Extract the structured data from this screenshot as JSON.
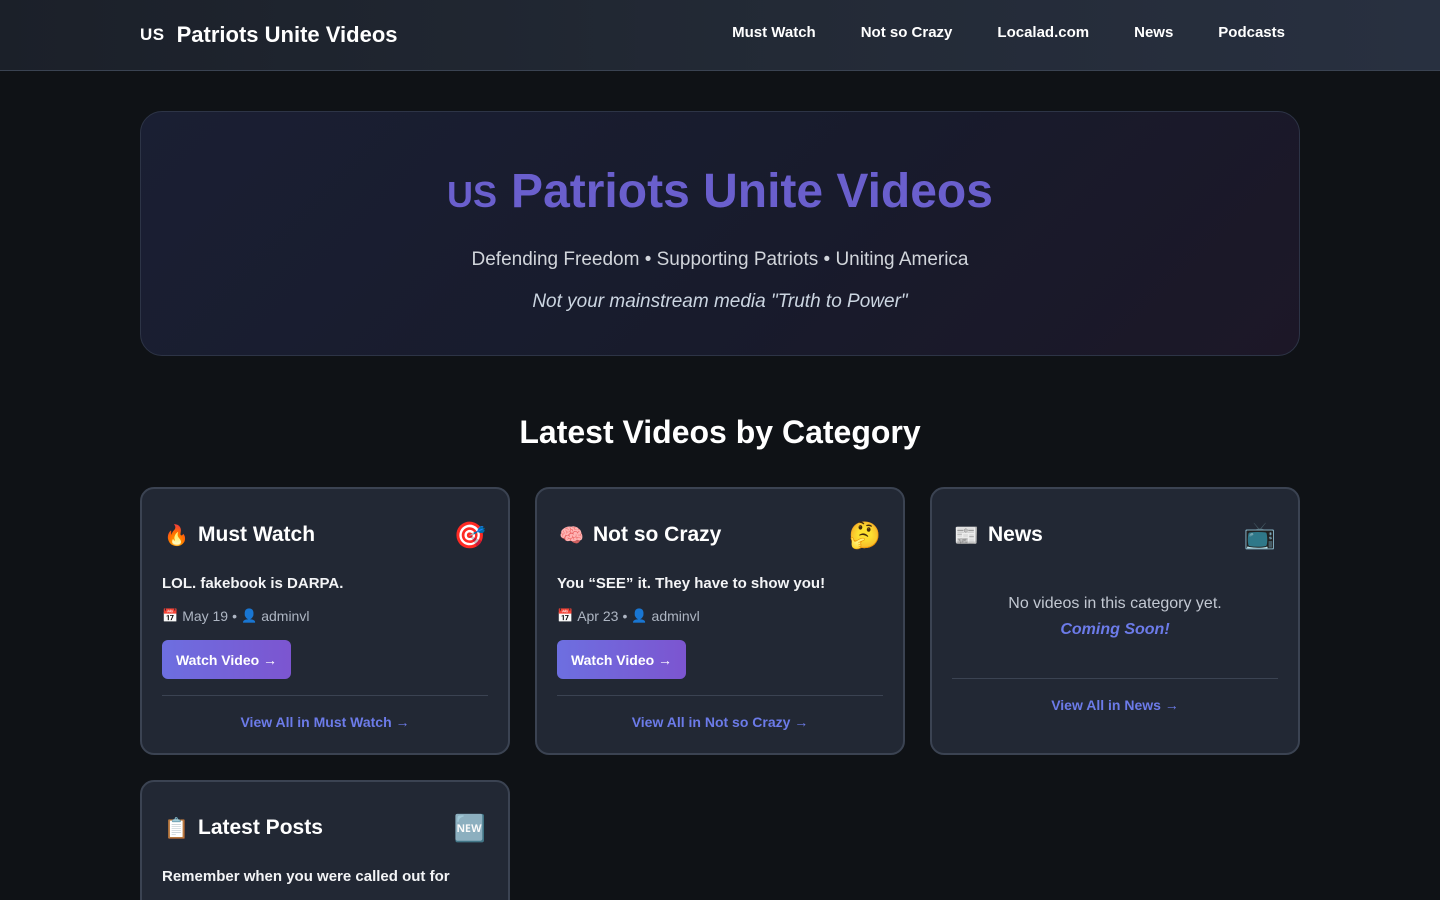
{
  "header": {
    "flag": "US",
    "site_name": "Patriots Unite Videos",
    "nav": [
      "Must Watch",
      "Not so Crazy",
      "Localad.com",
      "News",
      "Podcasts"
    ]
  },
  "hero": {
    "flag": "US",
    "title": "Patriots Unite Videos",
    "subtitle": "Defending Freedom • Supporting Patriots • Uniting America",
    "tagline": "Not your mainstream media \"Truth to Power\""
  },
  "section_title": "Latest Videos by Category",
  "cards": [
    {
      "icon": "🔥",
      "icon_name": "fire-icon",
      "name": "Must Watch",
      "badge": "🎯",
      "badge_name": "target-icon",
      "post_title": "LOL. fakebook is DARPA.",
      "date": "May 19",
      "author": "adminvl",
      "button": "Watch Video →",
      "view_all": "View All in Must Watch →"
    },
    {
      "icon": "🧠",
      "icon_name": "brain-icon",
      "name": "Not so Crazy",
      "badge": "🤔",
      "badge_name": "thinking-face-icon",
      "post_title": "You “SEE” it. They have to show you!",
      "date": "Apr 23",
      "author": "adminvl",
      "button": "Watch Video →",
      "view_all": "View All in Not so Crazy →"
    },
    {
      "icon": "📰",
      "icon_name": "newspaper-icon",
      "name": "News",
      "badge": "📺",
      "badge_name": "television-icon",
      "empty_message": "No videos in this category yet.",
      "coming_soon": "Coming Soon!",
      "view_all": "View All in News →"
    },
    {
      "icon": "📋",
      "icon_name": "clipboard-icon",
      "name": "Latest Posts",
      "badge": "🆕",
      "badge_name": "new-badge-icon",
      "post_title": "Remember when you were called out for"
    }
  ],
  "meta_icons": {
    "calendar": "📅",
    "user": "👤",
    "separator": "•"
  }
}
